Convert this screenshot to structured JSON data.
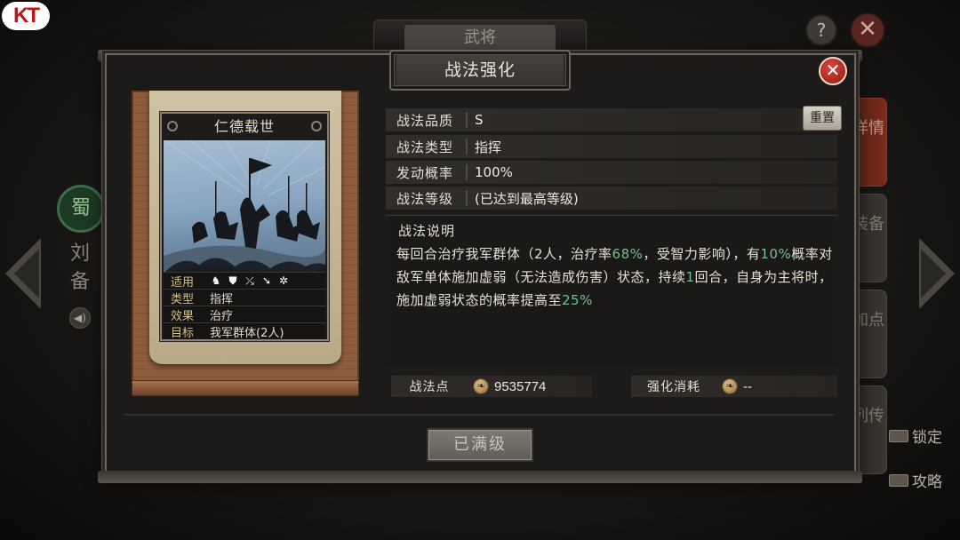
{
  "background": {
    "logo_text": "KT",
    "screen_title": "武将",
    "help_icon": "question-icon",
    "close_icon": "close-icon",
    "faction_glyph": "蜀",
    "general_name": "刘备",
    "side_tabs": [
      {
        "label": "详情",
        "active": true
      },
      {
        "label": "装备",
        "active": false
      },
      {
        "label": "加点",
        "active": false
      },
      {
        "label": "列传",
        "active": false
      }
    ],
    "lock_label": "锁定",
    "guide_label": "攻略"
  },
  "modal": {
    "title": "战法强化",
    "close_icon": "close-icon"
  },
  "tactic_card": {
    "name": "仁德载世",
    "props": {
      "apply_label": "适用",
      "apply_icons": [
        "cavalry-icon",
        "shield-icon",
        "bow-icon",
        "spear-icon",
        "wheel-icon"
      ],
      "type_label": "类型",
      "type_value": "指挥",
      "effect_label": "效果",
      "effect_value": "治疗",
      "target_label": "目标",
      "target_value": "我军群体(2人)"
    }
  },
  "info": {
    "quality_label": "战法品质",
    "quality_value": "S",
    "type_label": "战法类型",
    "type_value": "指挥",
    "rate_label": "发动概率",
    "rate_value": "100%",
    "level_label": "战法等级",
    "level_value": "(已达到最高等级)",
    "reset_label": "重置"
  },
  "description": {
    "title": "战法说明",
    "parts": [
      "每回合治疗我军群体（2人，治疗率",
      "68%",
      "，受智力影响），有",
      "10%",
      "概率对敌军单体施加虚弱（无法造成伤害）状态，持续",
      "1",
      "回合，自身为主将时，施加虚弱状态的概率提高至",
      "25%"
    ]
  },
  "points": {
    "label": "战法点",
    "value": "9535774",
    "cost_label": "强化消耗",
    "cost_value": "--"
  },
  "action": {
    "maxed_label": "已满级"
  },
  "colors": {
    "highlight": "#72c08f",
    "gold_label": "#d7bf87",
    "close_red": "#c23a2e"
  }
}
